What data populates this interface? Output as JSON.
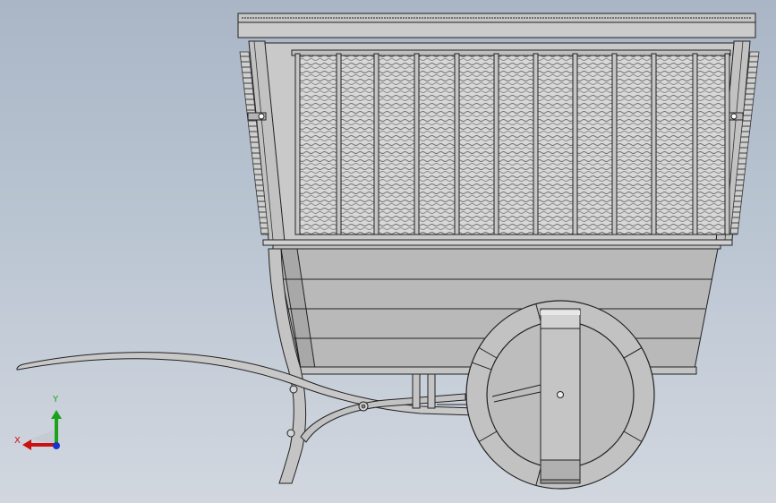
{
  "viewport": {
    "background_top": "#aab6c6",
    "background_bottom": "#d2d7df"
  },
  "model": {
    "subject": "cart",
    "line_color": "#1e1e1e",
    "body_color": "#b9b9b9",
    "wheel_color": "#bdbdbd",
    "mesh_color": "#cfcfcf"
  },
  "triad": {
    "y_label": "Y",
    "x_label": "X",
    "y_color": "#1aa31a",
    "x_color": "#cc1111",
    "z_color": "#1a34c9"
  }
}
